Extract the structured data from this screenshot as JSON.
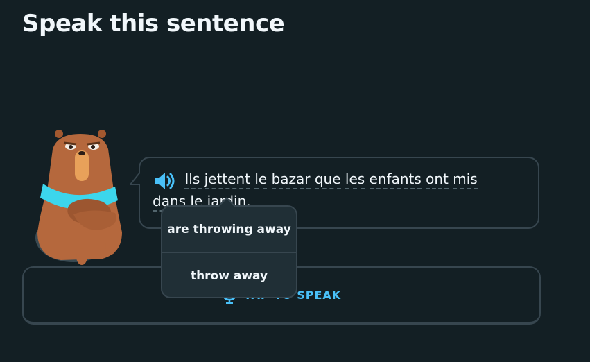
{
  "page": {
    "title": "Speak this sentence"
  },
  "sentence": {
    "words_line1": [
      "Ils jettent",
      "le",
      "bazar",
      "que",
      "les",
      "enfants",
      "ont",
      "mis"
    ],
    "words_line2": [
      "dans",
      "le",
      "jardin."
    ]
  },
  "tooltip": {
    "options": [
      "are throwing away",
      "throw away"
    ]
  },
  "speak_button": {
    "label": "TAP TO SPEAK"
  },
  "colors": {
    "background": "#131f24",
    "border": "#37464f",
    "accent": "#49c0f8",
    "text": "#f1f7fb"
  },
  "icons": {
    "speaker": "speaker-icon",
    "mic": "microphone-icon"
  }
}
